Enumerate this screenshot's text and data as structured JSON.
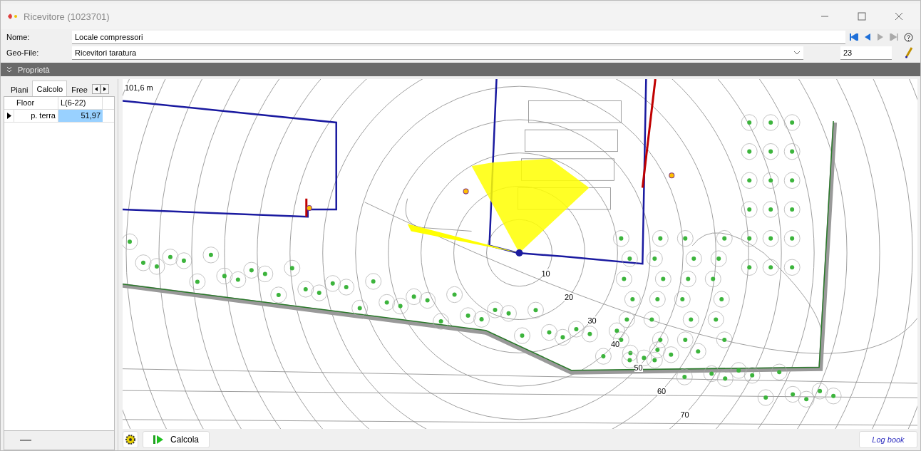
{
  "window": {
    "title": "Ricevitore (1023701)"
  },
  "form": {
    "name_label": "Nome:",
    "name_value": "Locale compressori",
    "geo_label": "Geo-File:",
    "geo_value": "Ricevitori taratura",
    "number_value": "23"
  },
  "section": {
    "title": "Proprietà",
    "expanded": true
  },
  "tabs": [
    {
      "label": "Piani",
      "selected": false
    },
    {
      "label": "Calcolo",
      "selected": true
    },
    {
      "label": "Free",
      "selected": false
    }
  ],
  "table": {
    "columns": [
      "Floor",
      "L(6-22)"
    ],
    "rows": [
      {
        "floor": "p. terra",
        "value": "51,97",
        "selected": true
      }
    ]
  },
  "map": {
    "scale": "101,6 m",
    "ring_labels": [
      "10",
      "20",
      "30",
      "40",
      "50",
      "60",
      "70"
    ]
  },
  "buttons": {
    "calculate": "Calcola",
    "log": "Log book"
  }
}
